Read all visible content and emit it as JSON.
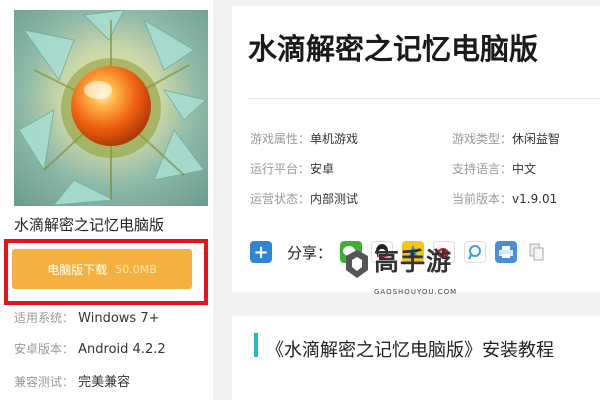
{
  "game": {
    "name": "水滴解密之记忆电脑版",
    "title": "水滴解密之记忆电脑版"
  },
  "download": {
    "label": "电脑版下载",
    "size": "50.0MB"
  },
  "specs": [
    {
      "key": "适用系统：",
      "value": "Windows 7+"
    },
    {
      "key": "安卓版本：",
      "value": "Android 4.2.2"
    },
    {
      "key": "兼容测试：",
      "value": "完美兼容"
    }
  ],
  "attributes": [
    {
      "key": "游戏属性：",
      "value": "单机游戏"
    },
    {
      "key": "游戏类型：",
      "value": "休闲益智"
    },
    {
      "key": "运行平台：",
      "value": "安卓"
    },
    {
      "key": "支持语言：",
      "value": "中文"
    },
    {
      "key": "运营状态：",
      "value": "内部测试"
    },
    {
      "key": "当前版本：",
      "value": "v1.9.01"
    }
  ],
  "share": {
    "label": "分享：",
    "icons": [
      "plus-icon",
      "wechat-icon",
      "qq-icon",
      "qzone-icon",
      "weibo-icon",
      "tencent-weibo-icon",
      "print-icon",
      "copy-icon"
    ]
  },
  "watermark": {
    "title": "高手游",
    "domain": "GAOSHOUYOU.COM"
  },
  "tutorial": {
    "title": "《水滴解密之记忆电脑版》安装教程"
  },
  "colors": {
    "download_button": "#f5b13f",
    "highlight_frame": "#e3141b",
    "accent": "#2bb9c2"
  }
}
